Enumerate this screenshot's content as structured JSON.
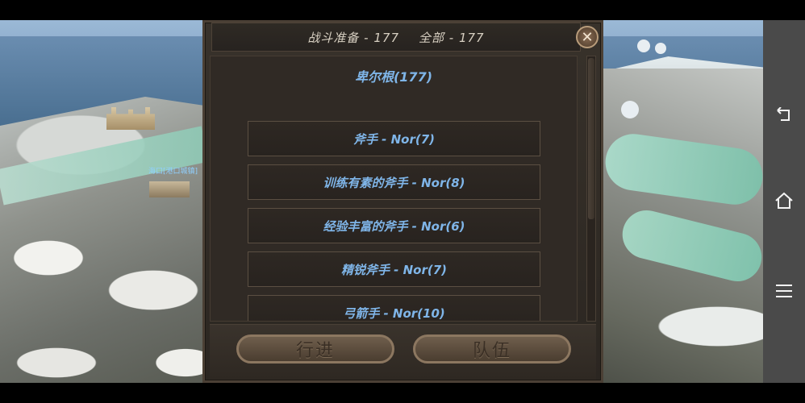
{
  "header": {
    "battle_ready": "战斗准备 - 177",
    "all": "全部 - 177"
  },
  "close_label": "✕",
  "group": {
    "title": "卑尔根(177)"
  },
  "troops": [
    {
      "label": "斧手 - Nor(7)"
    },
    {
      "label": "训练有素的斧手 - Nor(8)"
    },
    {
      "label": "经验丰富的斧手 - Nor(6)"
    },
    {
      "label": "精锐斧手 - Nor(7)"
    },
    {
      "label": "弓箭手 - Nor(10)"
    }
  ],
  "buttons": {
    "march": "行进",
    "party": "队伍"
  },
  "world": {
    "town_label": "海口[港口城镇]"
  },
  "system_bar": {
    "back_icon": "back-arrow-icon",
    "home_icon": "home-icon",
    "menu_icon": "menu-icon"
  },
  "colors": {
    "troop_text": "#7fb5e8",
    "panel_bg": "#2b2621"
  }
}
